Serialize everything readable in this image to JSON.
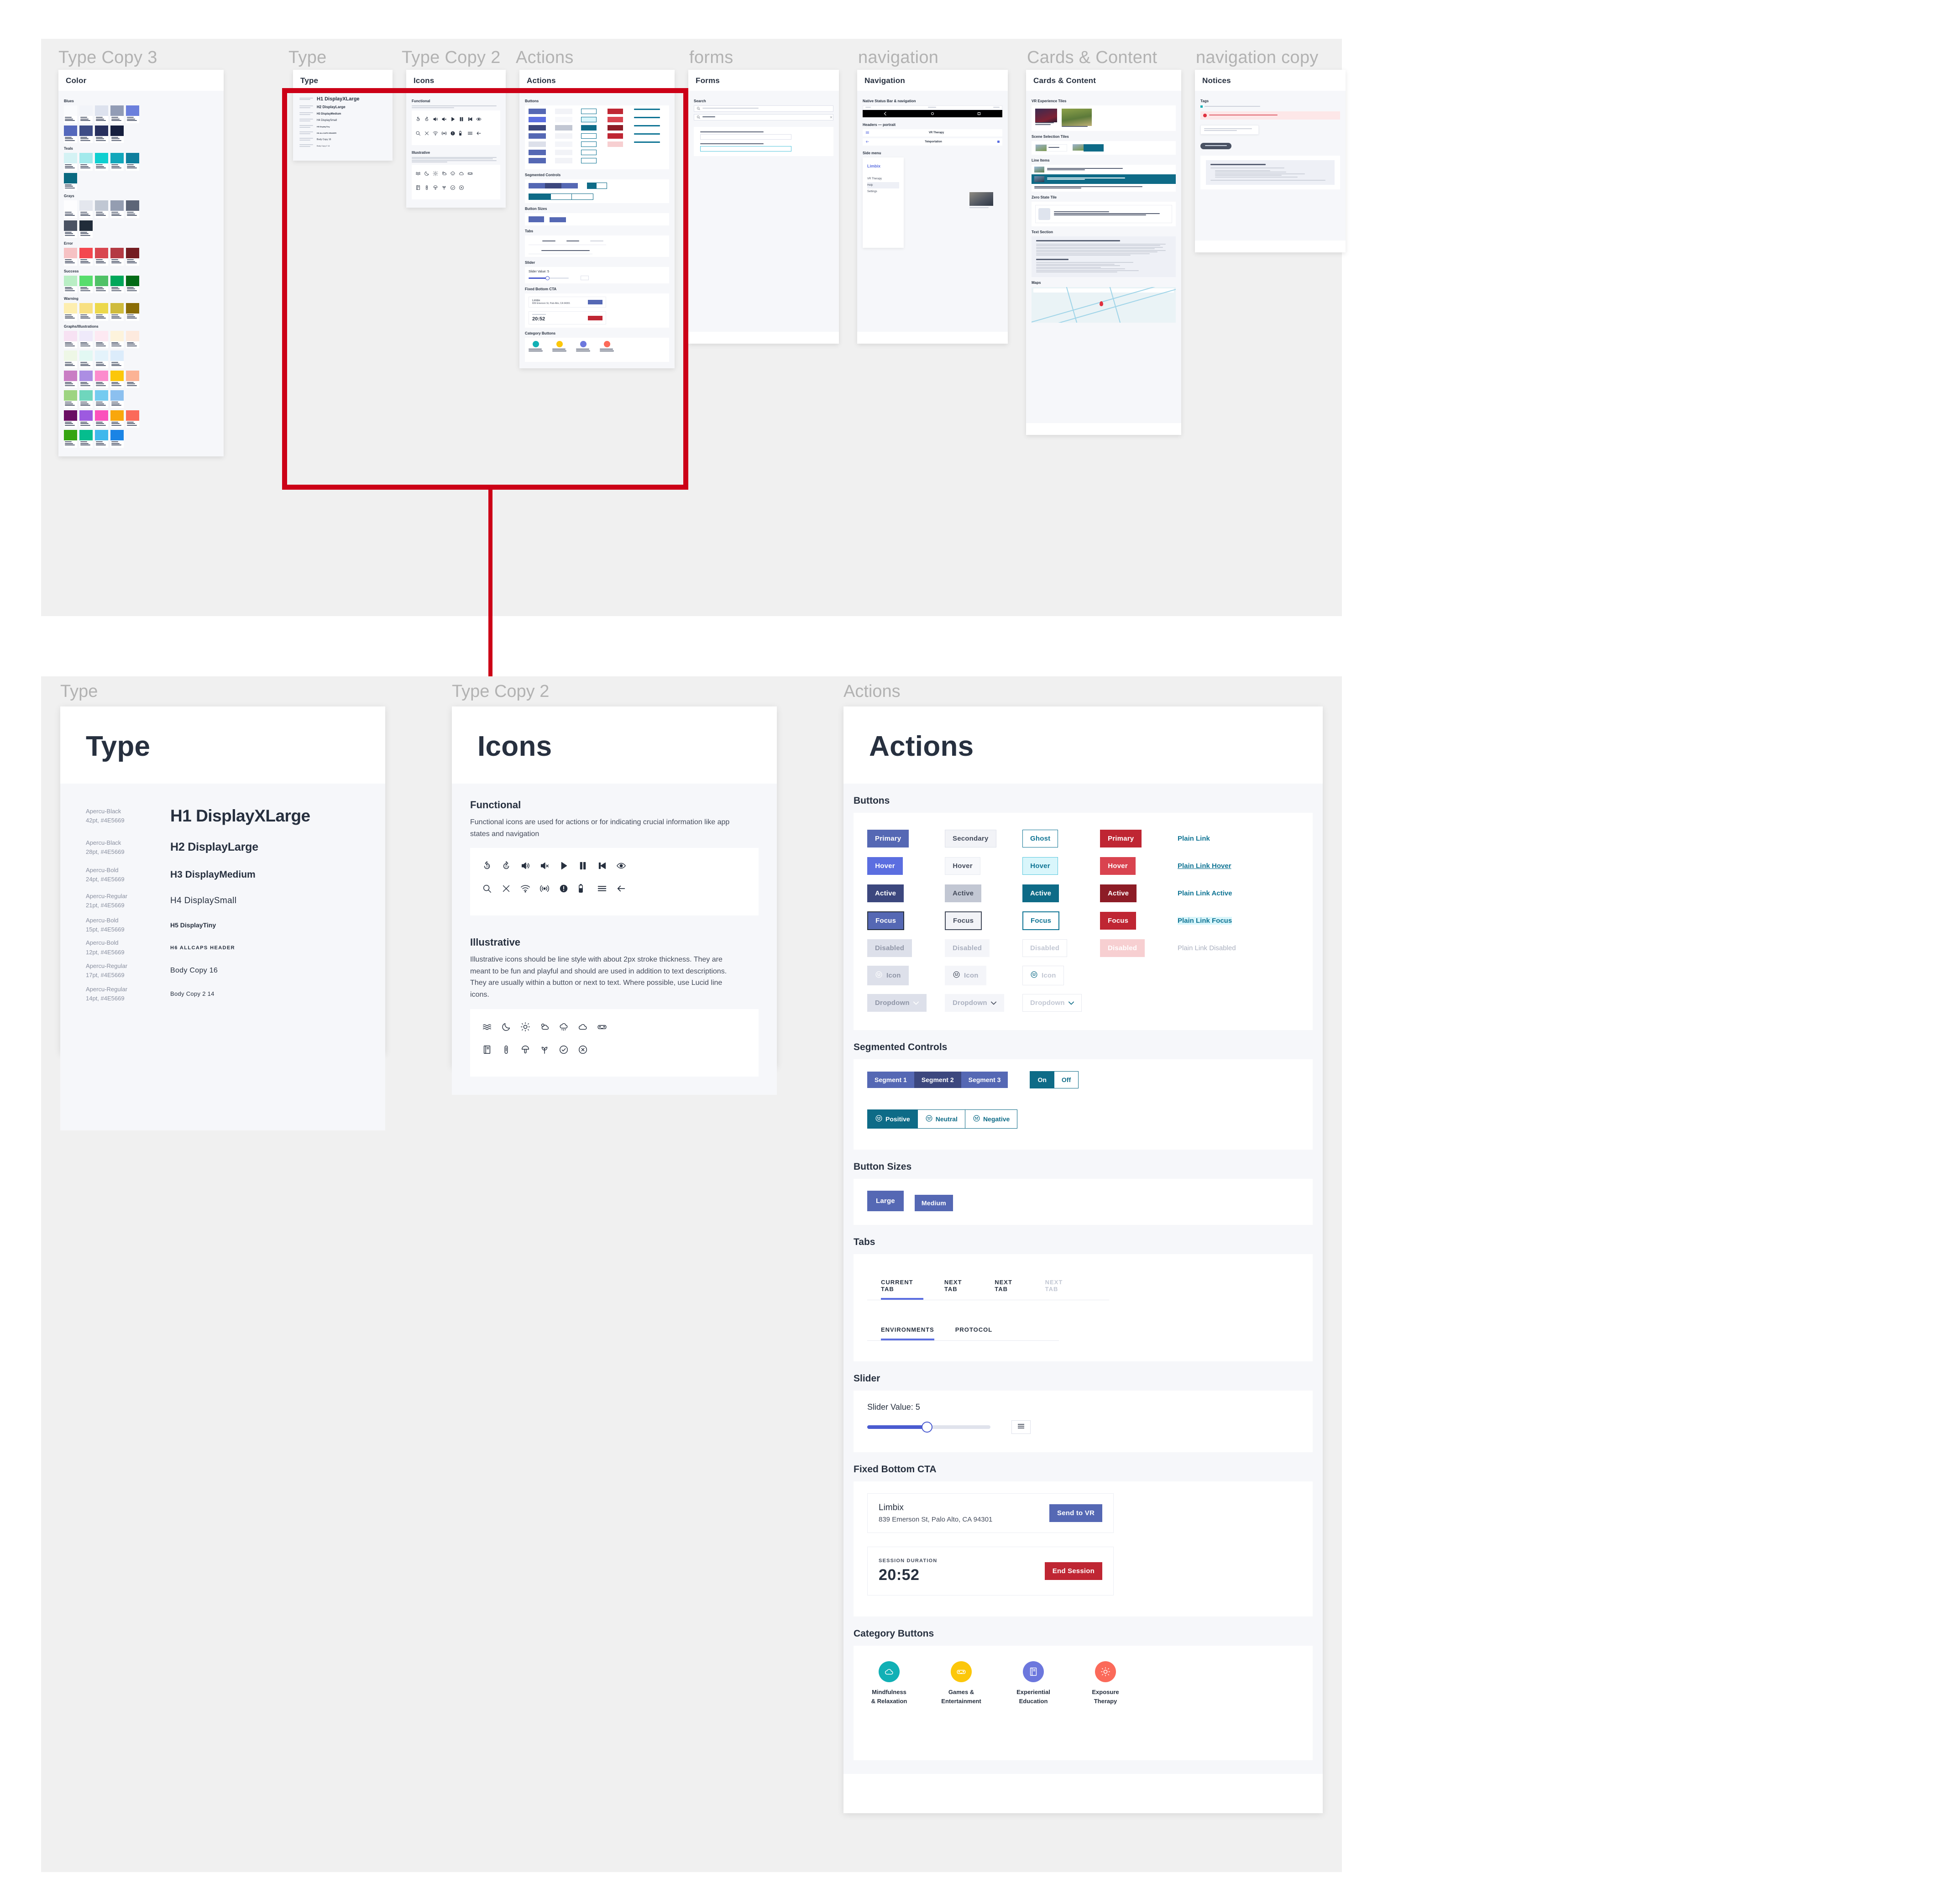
{
  "overview": {
    "frames": [
      {
        "label": "Type Copy 3"
      },
      {
        "label": "Type"
      },
      {
        "label": "Type Copy 2"
      },
      {
        "label": "Actions"
      },
      {
        "label": "forms"
      },
      {
        "label": "navigation"
      },
      {
        "label": "Cards & Content"
      },
      {
        "label": "navigation copy"
      }
    ],
    "mini_titles": {
      "color": "Color",
      "type": "Type",
      "icons": "Icons",
      "actions": "Actions",
      "forms": "Forms",
      "navigation": "Navigation",
      "cards": "Cards & Content",
      "notices": "Notices"
    },
    "color_groups": [
      "Blues",
      "Teals",
      "Grays",
      "Error",
      "Success",
      "Warning",
      "Graphs/Illustrations"
    ],
    "selection_color": "#cc0017"
  },
  "detail": {
    "frame_labels": {
      "type": "Type",
      "icons": "Type Copy 2",
      "actions": "Actions"
    }
  },
  "type_card": {
    "title": "Type",
    "rows": [
      {
        "meta": "Apercu-Black\n42pt, #4E5669",
        "sample": "H1 DisplayXLarge",
        "size": 37,
        "weight": "bold",
        "spacing": "-0.5px",
        "transform": "none"
      },
      {
        "meta": "Apercu-Black\n28pt, #4E5669",
        "sample": "H2 DisplayLarge",
        "size": 25,
        "weight": "bold",
        "spacing": "-0.2px",
        "transform": "none"
      },
      {
        "meta": "Apercu-Bold\n24pt, #4E5669",
        "sample": "H3 DisplayMedium",
        "size": 21,
        "weight": "bold",
        "spacing": "0px",
        "transform": "none"
      },
      {
        "meta": "Apercu-Regular\n21pt, #4E5669",
        "sample": "H4 DisplaySmall",
        "size": 19,
        "weight": "normal",
        "spacing": "0.4px",
        "transform": "none"
      },
      {
        "meta": "Apercu-Bold\n15pt, #4E5669",
        "sample": "H5 DisplayTiny",
        "size": 14,
        "weight": "bold",
        "spacing": "0px",
        "transform": "none"
      },
      {
        "meta": "Apercu-Bold\n12pt, #4E5669",
        "sample": "H6 ALLCAPS HEADER",
        "size": 11,
        "weight": "bold",
        "spacing": "1.4px",
        "transform": "uppercase"
      },
      {
        "meta": "Apercu-Regular\n17pt, #4E5669",
        "sample": "Body Copy 16",
        "size": 16,
        "weight": "normal",
        "spacing": "0.3px",
        "transform": "none"
      },
      {
        "meta": "Apercu-Regular\n14pt, #4E5669",
        "sample": "Body Copy 2 14",
        "size": 13,
        "weight": "normal",
        "spacing": "0.3px",
        "transform": "none"
      }
    ]
  },
  "icons_card": {
    "title": "Icons",
    "functional": {
      "heading": "Functional",
      "description": "Functional icons are used for actions or for indicating crucial information like app states and navigation",
      "icons": [
        "replay-10-icon",
        "rewind-10-icon",
        "volume-up-icon",
        "volume-mute-icon",
        "play-icon",
        "pause-icon",
        "skip-previous-icon",
        "visibility-icon",
        "search-icon",
        "close-icon",
        "wifi-icon",
        "broadcast-icon",
        "alert-icon",
        "battery-icon",
        "menu-icon",
        "arrow-back-icon"
      ]
    },
    "illustrative": {
      "heading": "Illustrative",
      "description": "Illustrative icons should be line style with about 2px stroke thickness. They are meant to be fun and playful and should are used in addition to text descriptions. They are usually within a button or next to text. Where possible, use Lucid line icons.",
      "icons": [
        "waves-icon",
        "moon-icon",
        "sun-icon",
        "cloud-sun-icon",
        "rain-icon",
        "cloud-icon",
        "vr-goggles-icon",
        "book-icon",
        "thermometer-icon",
        "mushroom-icon",
        "plant-icon",
        "check-circle-icon",
        "close-circle-icon"
      ]
    }
  },
  "actions_card": {
    "title": "Actions",
    "sections": {
      "buttons": "Buttons",
      "segmented": "Segmented Controls",
      "sizes": "Button Sizes",
      "tabs": "Tabs",
      "slider": "Slider",
      "cta": "Fixed Bottom CTA",
      "category": "Category Buttons"
    },
    "buttons": {
      "columns": [
        {
          "name": "primary",
          "cells": [
            "Primary",
            "Hover",
            "Active",
            "Focus",
            "Disabled",
            "Icon",
            "Dropdown"
          ]
        },
        {
          "name": "secondary",
          "cells": [
            "Secondary",
            "Hover",
            "Active",
            "Focus",
            "Disabled",
            "Icon",
            "Dropdown"
          ]
        },
        {
          "name": "ghost",
          "cells": [
            "Ghost",
            "Hover",
            "Active",
            "Focus",
            "Disabled",
            "Icon",
            "Dropdown"
          ]
        },
        {
          "name": "danger",
          "cells": [
            "Primary",
            "Hover",
            "Active",
            "Focus",
            "Disabled"
          ]
        },
        {
          "name": "link",
          "cells": [
            "Plain Link",
            "Plain Link Hover",
            "Plain Link Active",
            "Plain Link Focus",
            "Plain Link Disabled"
          ]
        }
      ]
    },
    "segmented": {
      "triple": [
        "Segment 1",
        "Segment 2",
        "Segment 3"
      ],
      "triple_selected_index": 1,
      "toggle": [
        "On",
        "Off"
      ],
      "toggle_selected_index": 0,
      "sentiment": [
        "Positive",
        "Neutral",
        "Negative"
      ],
      "sentiment_selected_index": 0
    },
    "sizes": [
      "Large",
      "Medium"
    ],
    "tabs": {
      "row1": [
        "CURRENT TAB",
        "NEXT TAB",
        "NEXT TAB",
        "NEXT TAB"
      ],
      "row1_current": 0,
      "row1_disabled": 3,
      "row2": [
        "ENVIRONMENTS",
        "PROTOCOL"
      ],
      "row2_current": 0
    },
    "slider": {
      "label": "Slider Value: 5",
      "value": 5,
      "min": 0,
      "max": 10,
      "button_icon": "menu-icon"
    },
    "cta": {
      "location_name": "Limbix",
      "location_address": "839 Emerson St, Palo Alto, CA 94301",
      "send_button": "Send to VR",
      "duration_label": "SESSION DURATION",
      "duration_value": "20:52",
      "end_button": "End Session"
    },
    "category_buttons": [
      {
        "label": "Mindfulness\n& Relaxation",
        "color": "#11b0b5",
        "icon": "cloud-icon"
      },
      {
        "label": "Games &\nEntertainment",
        "color": "#fcc70a",
        "icon": "gamepad-icon"
      },
      {
        "label": "Experiential\nEducation",
        "color": "#6c77dd",
        "icon": "book-icon"
      },
      {
        "label": "Exposure\nTherapy",
        "color": "#fb6a5a",
        "icon": "sun-icon"
      }
    ]
  },
  "colors": {
    "primary_blue": "#5568b4",
    "teal": "#0e6b87",
    "danger_red": "#bf2633",
    "ink": "#27303f",
    "panel_bg": "#f6f7fa",
    "canvas_bg": "#f0f0f0"
  }
}
